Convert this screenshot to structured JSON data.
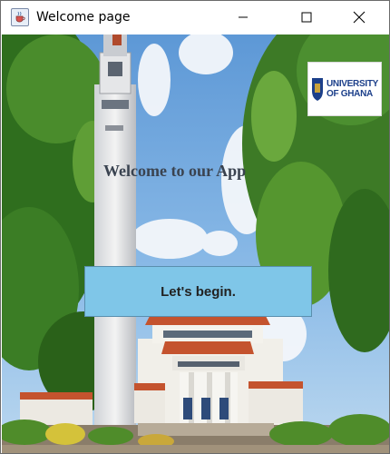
{
  "window": {
    "title": "Welcome page",
    "icon": "java-cup-icon",
    "controls": {
      "minimize_icon": "minimize-icon",
      "maximize_icon": "maximize-icon",
      "close_icon": "close-icon"
    }
  },
  "main": {
    "welcome_text": "Welcome to our App",
    "begin_button_label": "Let's begin.",
    "logo": {
      "line1": "UNIVERSITY",
      "line2": "OF GHANA"
    }
  },
  "colors": {
    "button_bg": "#7fc6e8",
    "sky": "#6fa6dc",
    "foliage": "#3f7d2a",
    "roof": "#c4532e"
  }
}
